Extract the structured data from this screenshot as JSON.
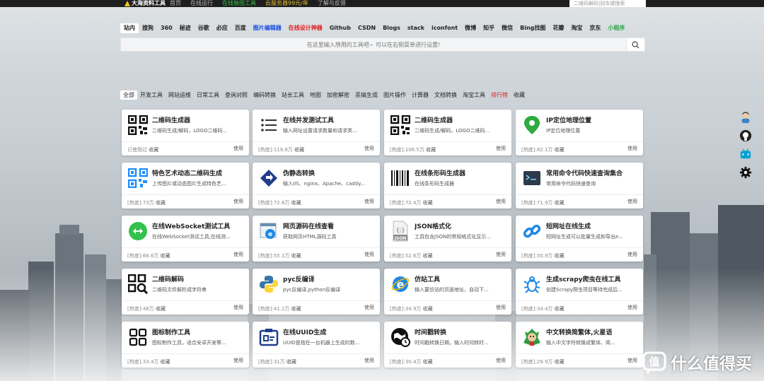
{
  "topbar": {
    "logo": "大海资料工具",
    "nav": [
      "首页",
      "在线运行",
      "在线做图工具",
      "云服务器99元/年",
      "了解与反馈"
    ],
    "search_placeholder": "二维码解码|回车键搜索"
  },
  "engines": [
    "站内",
    "搜狗",
    "360",
    "秘迹",
    "谷歌",
    "必应",
    "百度",
    "图片编辑器",
    "在线设计神器",
    "Github",
    "CSDN",
    "Blogs",
    "stack",
    "iconfont",
    "微博",
    "知乎",
    "微信",
    "Bing找图",
    "花瓣",
    "淘宝",
    "京东",
    "小程序"
  ],
  "search": {
    "placeholder": "在这里输入想用的工具吧~ 可以在右侧菜单进行设置!"
  },
  "categories": [
    "全部",
    "开发工具",
    "网站运维",
    "日常工具",
    "查询对照",
    "编码转换",
    "站长工具",
    "地图",
    "加密解密",
    "恶搞生成",
    "图片操作",
    "计算器",
    "文档转换",
    "淘宝工具",
    "排行榜",
    "收藏"
  ],
  "cards": [
    {
      "title": "二维码生成器",
      "desc": "二维码生成/解码，LOGO二维码...",
      "hot": "已使用过",
      "fav": "收藏",
      "use": "使用",
      "icon": "qrcode-icon"
    },
    {
      "title": "在线并发测试工具",
      "desc": "输入网址设置请求数量和请求类...",
      "hot": "[热度]:119.8万",
      "fav": "收藏",
      "use": "使用",
      "icon": "list-icon"
    },
    {
      "title": "二维码生成器",
      "desc": "二维码生成/解码，LOGO二维码...",
      "hot": "[热度]:106.5万",
      "fav": "收藏",
      "use": "使用",
      "icon": "qrcode-icon"
    },
    {
      "title": "IP定位地理位置",
      "desc": "IP定位地理位置",
      "hot": "[热度]:82.1万",
      "fav": "收藏",
      "use": "使用",
      "icon": "map-pin-icon"
    },
    {
      "title": "特色艺术动态二维码生成",
      "desc": "上传图片或动态图片生成特色艺...",
      "hot": "[热度]:73万",
      "fav": "收藏",
      "use": "使用",
      "icon": "qrcode-color-icon"
    },
    {
      "title": "伪静态转换",
      "desc": "输入IIS、nginx、Apache、caddy...",
      "hot": "[热度]:72.8万",
      "fav": "收藏",
      "use": "使用",
      "icon": "convert-icon"
    },
    {
      "title": "在线条形码生成器",
      "desc": "在线条形码生成器",
      "hot": "[热度]:72.4万",
      "fav": "收藏",
      "use": "使用",
      "icon": "barcode-icon"
    },
    {
      "title": "常用命令代码快速查询集合",
      "desc": "常用命令代码快速查询",
      "hot": "[热度]:71.9万",
      "fav": "收藏",
      "use": "使用",
      "icon": "terminal-icon"
    },
    {
      "title": "在线WebSocket测试工具",
      "desc": "在线WebSocket测试工具,在线测...",
      "hot": "[热度]:66.6万",
      "fav": "收藏",
      "use": "使用",
      "icon": "websocket-icon"
    },
    {
      "title": "网页源码在线查看",
      "desc": "获取网页HTML源码工具",
      "hot": "[热度]:55.1万",
      "fav": "收藏",
      "use": "使用",
      "icon": "webpage-icon"
    },
    {
      "title": "JSON格式化",
      "desc": "工具包含JSON的常规格式化显示...",
      "hot": "[热度]:52.6万",
      "fav": "收藏",
      "use": "使用",
      "icon": "json-icon"
    },
    {
      "title": "短网址在线生成",
      "desc": "短网址生成可以批量生成和导出e...",
      "hot": "[热度]:50.9万",
      "fav": "收藏",
      "use": "使用",
      "icon": "link-icon"
    },
    {
      "title": "二维码解码",
      "desc": "二维码文件解析成字符串",
      "hot": "[热度]:48万",
      "fav": "收藏",
      "use": "使用",
      "icon": "qrcode-scan-icon"
    },
    {
      "title": "pyc反编译",
      "desc": "pyc反编译,python反编译",
      "hot": "[热度]:41.2万",
      "fav": "收藏",
      "use": "使用",
      "icon": "python-icon"
    },
    {
      "title": "仿站工具",
      "desc": "输入要仿站的页面地址，自动下...",
      "hot": "[热度]:34.9万",
      "fav": "收藏",
      "use": "使用",
      "icon": "ie-icon"
    },
    {
      "title": "生成scrapy爬虫在线工具",
      "desc": "创建Scrapy爬虫项目等待完成后...",
      "hot": "[热度]:34.4万",
      "fav": "收藏",
      "use": "使用",
      "icon": "bug-icon"
    },
    {
      "title": "图标制作工具",
      "desc": "图标制作工具，适合安卓开发等...",
      "hot": "[热度]:33.4万",
      "fav": "收藏",
      "use": "使用",
      "icon": "grid-icon"
    },
    {
      "title": "在线UUID生成",
      "desc": "UUID是指在一台机器上生成的数...",
      "hot": "[热度]:31万",
      "fav": "收藏",
      "use": "使用",
      "icon": "id-card-icon"
    },
    {
      "title": "时间戳转换",
      "desc": "时间戳转换日期，输入时间转时...",
      "hot": "[热度]:30.4万",
      "fav": "收藏",
      "use": "使用",
      "icon": "clock-globe-icon"
    },
    {
      "title": "中文转换简繁体,火星语",
      "desc": "输入中文字符转换成繁体、简...",
      "hot": "[热度]:29.9万",
      "fav": "收藏",
      "use": "使用",
      "icon": "avatar-icon"
    }
  ],
  "sidebar": [
    "avatar-icon",
    "github-icon",
    "bilibili-icon",
    "gear-icon"
  ],
  "watermark": "什么值得买"
}
